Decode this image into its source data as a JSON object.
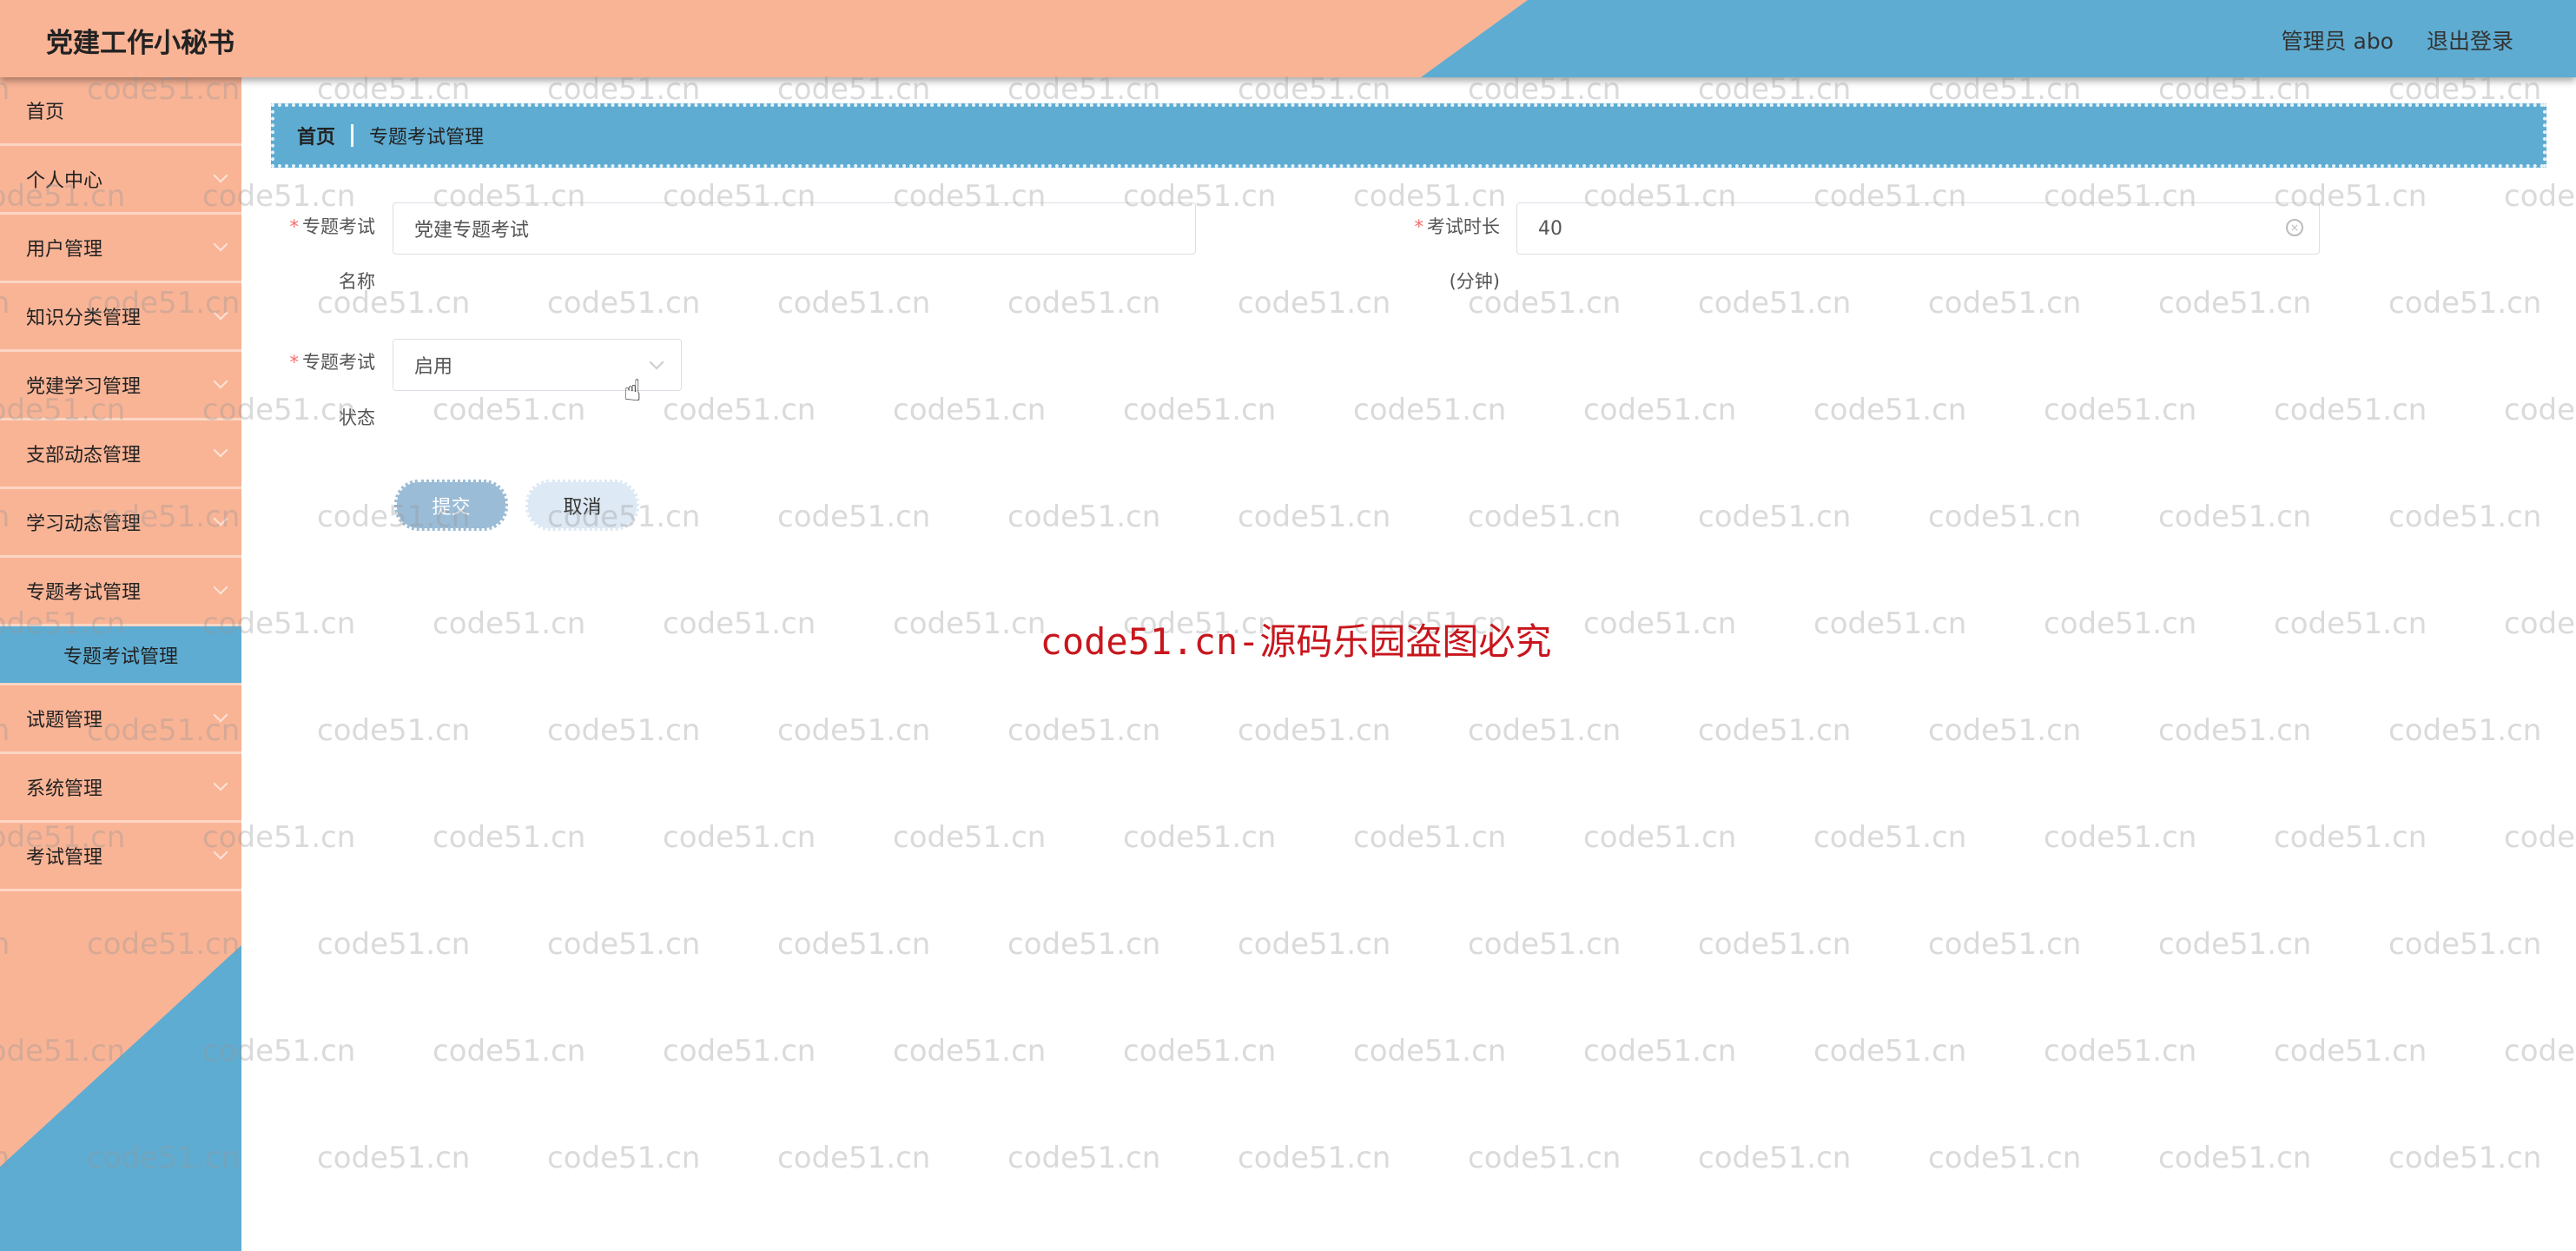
{
  "header": {
    "title": "党建工作小秘书",
    "user": "管理员 abo",
    "logout": "退出登录",
    "colors": {
      "primary": "#f9b496",
      "accent": "#5eacd2"
    }
  },
  "sidebar": {
    "items": [
      {
        "label": "首页",
        "arrow": false
      },
      {
        "label": "个人中心",
        "arrow": true
      },
      {
        "label": "用户管理",
        "arrow": true
      },
      {
        "label": "知识分类管理",
        "arrow": true
      },
      {
        "label": "党建学习管理",
        "arrow": true
      },
      {
        "label": "支部动态管理",
        "arrow": true
      },
      {
        "label": "学习动态管理",
        "arrow": true
      },
      {
        "label": "专题考试管理",
        "arrow": true
      }
    ],
    "active_sub": "专题考试管理",
    "items_after": [
      {
        "label": "试题管理"
      },
      {
        "label": "系统管理"
      },
      {
        "label": "考试管理"
      }
    ]
  },
  "breadcrumb": [
    "首页",
    "专题考试管理"
  ],
  "form": {
    "name": {
      "label1": "专题考试",
      "label2": "名称",
      "value": "党建专题考试"
    },
    "duration": {
      "label1": "考试时长",
      "label2": "(分钟)",
      "value": "40"
    },
    "status": {
      "label1": "专题考试",
      "label2": "状态",
      "value": "启用"
    },
    "submit": "提交",
    "cancel": "取消"
  },
  "watermark": {
    "text": "code51.cn",
    "banner": "code51.cn-源码乐园盗图必究"
  }
}
